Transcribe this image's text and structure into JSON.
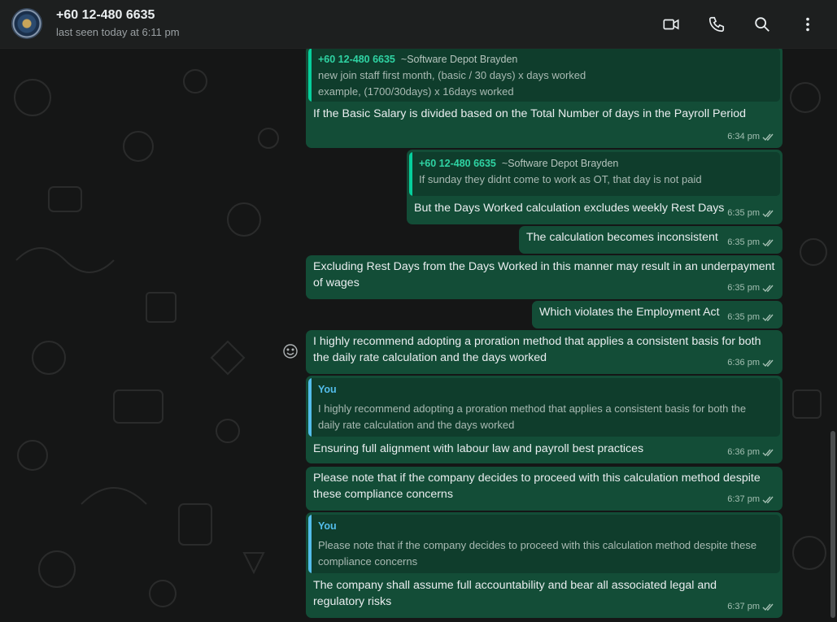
{
  "header": {
    "contact_name": "+60 12-480 6635",
    "status": "last seen today at 6:11 pm",
    "icons": [
      "video-call-icon",
      "voice-call-icon",
      "search-icon",
      "menu-icon"
    ]
  },
  "colors": {
    "outgoing_bubble": "#134d37",
    "quote_bg": "#0f3d2c",
    "quote_green_accent": "#06cf9c",
    "quote_blue_accent": "#53bdeb",
    "header_bg": "#1d1f1f",
    "chat_bg": "#151616"
  },
  "messages": [
    {
      "quote": {
        "author": "+60 12-480 6635",
        "sub": "~Software Depot Brayden",
        "lines": [
          "new join staff first month, (basic / 30 days) x days worked",
          "example, (1700/30days) x 16days worked"
        ]
      },
      "lines": [
        "If the Basic Salary is divided based on the Total Number of days in the Payroll Period"
      ],
      "time": "6:34 pm"
    },
    {
      "quote": {
        "author": "+60 12-480 6635",
        "sub": "~Software Depot Brayden",
        "lines": [
          "If sunday they didnt come to work as OT, that day is not paid"
        ]
      },
      "lines": [
        "But the Days Worked calculation excludes weekly Rest Days"
      ],
      "time": "6:35 pm"
    },
    {
      "lines": [
        "The calculation becomes inconsistent"
      ],
      "time": "6:35 pm"
    },
    {
      "lines": [
        "Excluding Rest Days from the Days Worked in this manner may result in an underpayment",
        "of wages"
      ],
      "time": "6:35 pm"
    },
    {
      "lines": [
        "Which violates the Employment Act"
      ],
      "time": "6:35 pm"
    },
    {
      "lines": [
        "I highly recommend adopting a proration method that applies a consistent basis for both",
        "the daily rate calculation and the days worked"
      ],
      "time": "6:36 pm"
    },
    {
      "quote": {
        "author": "You",
        "lines": [
          "I highly recommend adopting a proration method that applies a consistent basis for both the",
          "daily rate calculation and the days worked"
        ]
      },
      "lines": [
        "Ensuring full alignment with labour law and payroll best practices"
      ],
      "time": "6:36 pm"
    },
    {
      "lines": [
        "Please note that if the company decides to proceed with this calculation method despite",
        "these compliance concerns"
      ],
      "time": "6:37 pm"
    },
    {
      "quote": {
        "author": "You",
        "lines": [
          "Please note that if the company decides to proceed with this calculation method despite these",
          "compliance concerns"
        ]
      },
      "lines": [
        "The company shall assume full accountability and bear all associated legal and",
        "regulatory risks"
      ],
      "time": "6:37 pm"
    }
  ]
}
